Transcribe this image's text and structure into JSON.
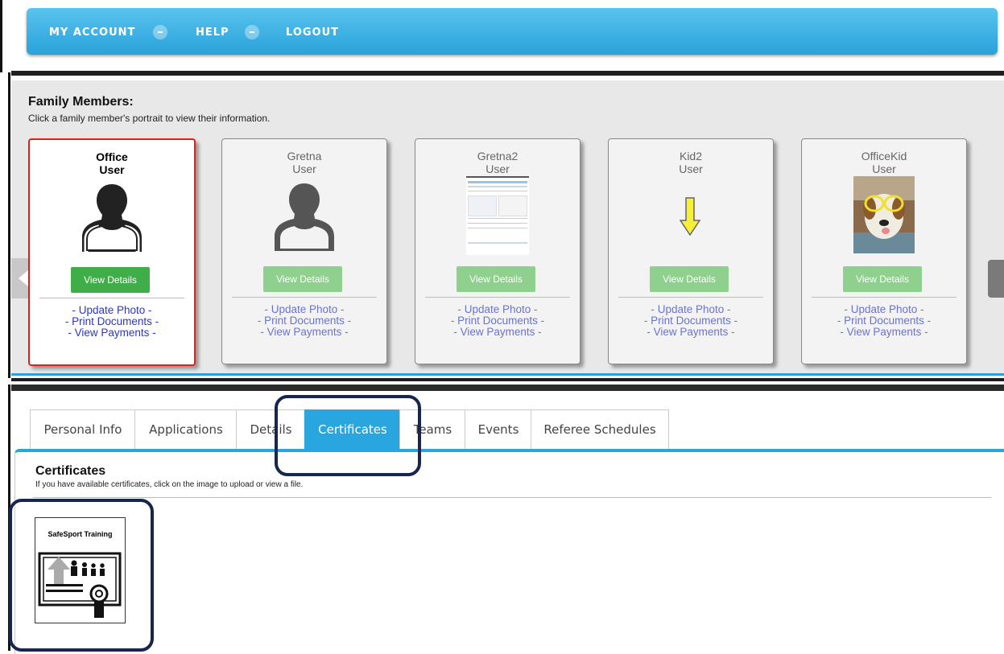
{
  "nav": {
    "items": [
      {
        "label": "MY ACCOUNT",
        "dropdown": true
      },
      {
        "label": "HELP",
        "dropdown": true
      },
      {
        "label": "LOGOUT",
        "dropdown": false
      }
    ]
  },
  "family": {
    "title": "Family Members:",
    "subtitle": "Click a family member's portrait to view their information.",
    "members": [
      {
        "first": "Office",
        "last": "User",
        "photo": "silhouette-dark",
        "selected": true
      },
      {
        "first": "Gretna",
        "last": "User",
        "photo": "silhouette-gray",
        "selected": false
      },
      {
        "first": "Gretna2",
        "last": "User",
        "photo": "screenshot-thumbnail",
        "selected": false
      },
      {
        "first": "Kid2",
        "last": "User",
        "photo": "yellow-down-arrow",
        "selected": false
      },
      {
        "first": "OfficeKid",
        "last": "User",
        "photo": "dog-with-glasses",
        "selected": false
      }
    ],
    "view_details_label": "View Details",
    "links": [
      "- Update Photo -",
      "- Print Documents -",
      "- View Payments -"
    ]
  },
  "tabs": {
    "items": [
      "Personal Info",
      "Applications",
      "Details",
      "Certificates",
      "Teams",
      "Events",
      "Referee Schedules"
    ],
    "active": "Certificates"
  },
  "certificates": {
    "title": "Certificates",
    "subtitle": "If you have available certificates, click on the image to upload or view a file.",
    "items": [
      {
        "label": "SafeSport Training",
        "icon": "certificate-upload-icon"
      }
    ]
  },
  "colors": {
    "nav_blue": "#2aa2d9",
    "selected_border": "#e02020",
    "view_details_green": "#3fae49",
    "link_blue": "#2a36c8",
    "tab_active": "#29a6dd",
    "annotation_outline": "#16264f"
  }
}
